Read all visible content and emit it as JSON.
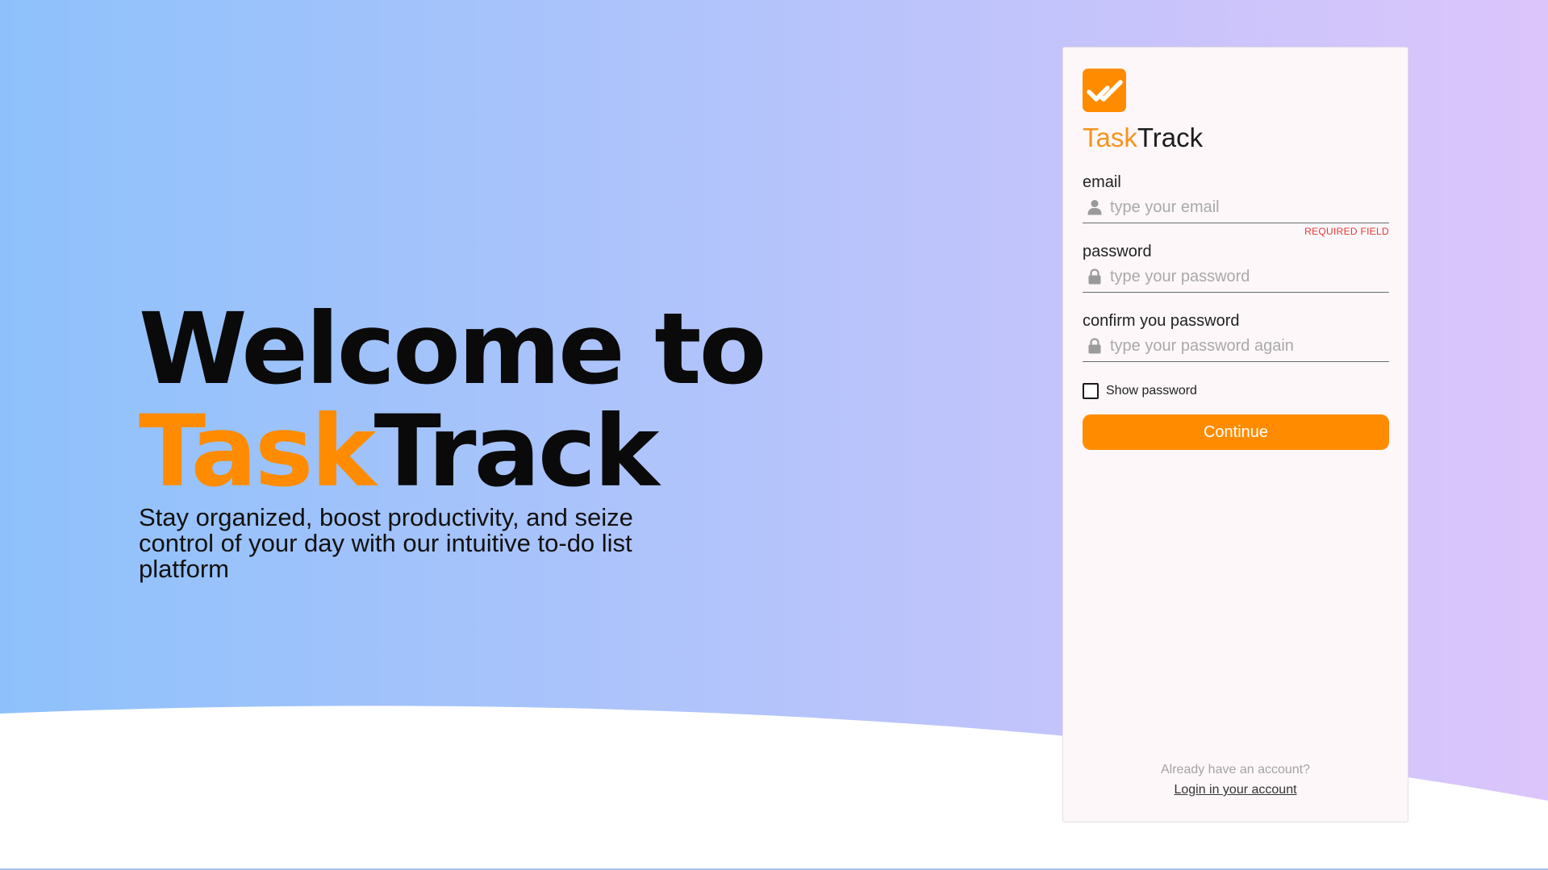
{
  "hero": {
    "title_line1": "Welcome to",
    "title_accent": "Task",
    "title_rest": "Track",
    "subtitle": "Stay organized, boost productivity, and seize control of your day with our intuitive to-do list platform"
  },
  "card": {
    "logo_icon": "double-check-icon",
    "brand_accent": "Task",
    "brand_rest": "Track",
    "email": {
      "label": "email",
      "placeholder": "type your email",
      "value": "",
      "icon": "user-icon",
      "error": "REQUIRED FIELD"
    },
    "password": {
      "label": "password",
      "placeholder": "type your password",
      "value": "",
      "icon": "lock-icon"
    },
    "confirm_password": {
      "label": "confirm you password",
      "placeholder": "type your password again",
      "value": "",
      "icon": "lock-icon"
    },
    "show_password_label": "Show password",
    "continue_label": "Continue",
    "footer_text": "Already have an account?",
    "footer_link": "Login in your account"
  },
  "colors": {
    "accent": "#ff8c00",
    "gradient_start": "#8ec1fb",
    "gradient_end": "#dcc5fb",
    "error": "#e53935"
  }
}
